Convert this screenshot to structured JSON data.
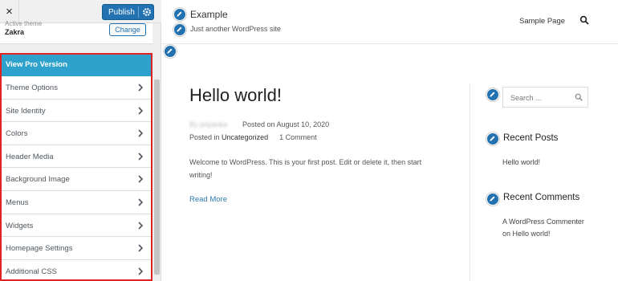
{
  "customizer": {
    "close_label": "×",
    "publish_label": "Publish",
    "theme": {
      "active_label": "Active theme",
      "name": "Zakra",
      "change_label": "Change"
    },
    "pro_label": "View Pro Version",
    "menu_items": [
      "Theme Options",
      "Site Identity",
      "Colors",
      "Header Media",
      "Background Image",
      "Menus",
      "Widgets",
      "Homepage Settings",
      "Additional CSS"
    ]
  },
  "site": {
    "title": "Example",
    "tagline": "Just another WordPress site",
    "nav_item": "Sample Page"
  },
  "post": {
    "title": "Hello world!",
    "author": "By priyanka",
    "posted_on_label": "Posted on",
    "date": "August 10, 2020",
    "posted_in_label": "Posted in",
    "category": "Uncategorized",
    "comments": "1 Comment",
    "excerpt": "Welcome to WordPress. This is your first post. Edit or delete it, then start writing!",
    "read_more": "Read More"
  },
  "sidebar_widgets": {
    "search_placeholder": "Search ...",
    "recent_posts_title": "Recent Posts",
    "recent_post_link": "Hello world!",
    "recent_comments_title": "Recent Comments",
    "comment_author": "A WordPress Commenter",
    "comment_on": "on",
    "comment_post": "Hello world!"
  },
  "colors": {
    "accent": "#2271b1",
    "pro_bg": "#2ea2cc",
    "highlight": "#e02424"
  }
}
